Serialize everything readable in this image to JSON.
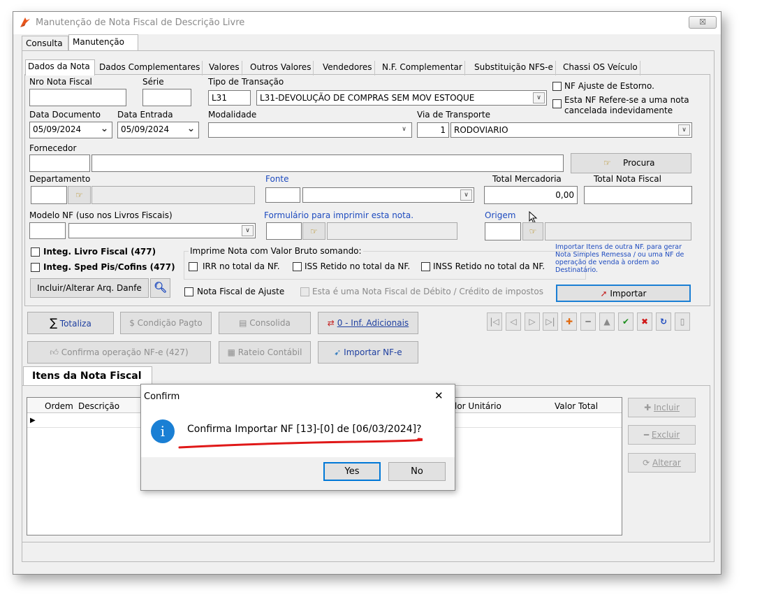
{
  "window": {
    "title": "Manutenção de Nota Fiscal de Descrição Livre",
    "close_label": "☒"
  },
  "top_tabs": [
    "Consulta",
    "Manutenção"
  ],
  "inner_tabs": [
    "Dados da Nota",
    "Dados Complementares",
    "Valores",
    "Outros Valores",
    "Vendedores",
    "N.F. Complementar",
    "Substituição NFS-e",
    "Chassi OS Veículo"
  ],
  "form": {
    "nro_nf_label": "Nro Nota Fiscal",
    "serie_label": "Série",
    "tipo_transacao_label": "Tipo de Transação",
    "tipo_transacao_code": "L31",
    "tipo_transacao_desc": "L31-DEVOLUÇÃO DE COMPRAS SEM MOV ESTOQUE",
    "nf_ajuste_estorno": "NF Ajuste de Estorno.",
    "nf_cancelada_line1": "Esta NF Refere-se a uma nota",
    "nf_cancelada_line2": "cancelada indevidamente",
    "data_documento_label": "Data Documento",
    "data_documento": "05/09/2024",
    "data_entrada_label": "Data Entrada",
    "data_entrada": "05/09/2024",
    "modalidade_label": "Modalidade",
    "via_transporte_label": "Via de Transporte",
    "via_transporte_code": "1",
    "via_transporte_desc": "RODOVIARIO",
    "fornecedor_label": "Fornecedor",
    "procura_label": "Procura",
    "departamento_label": "Departamento",
    "fonte_label": "Fonte",
    "total_mercadoria_label": "Total Mercadoria",
    "total_mercadoria": "0,00",
    "total_nf_label": "Total Nota Fiscal",
    "modelo_nf_label": "Modelo NF (uso nos Livros Fiscais)",
    "formulario_label": "Formulário para imprimir esta nota.",
    "origem_label": "Origem",
    "integ_livro_fiscal": "Integ. Livro Fiscal (477)",
    "integ_sped": "Integ. Sped Pis/Cofins (477)",
    "imprime_group_label": "Imprime Nota com Valor Bruto somando:",
    "irr_label": "IRR no total da NF.",
    "iss_label": "ISS Retido no total da NF.",
    "inss_label": "INSS Retido no total da NF.",
    "importar_info": "Importar Itens de outra NF. para gerar Nota Simples Remessa / ou uma NF de operação de venda à ordem ao Destinatário.",
    "incluir_danfe_label": "Incluir/Alterar Arq. Danfe",
    "nf_ajuste_label": "Nota Fiscal de Ajuste",
    "nf_debito_label": "Esta é uma Nota Fiscal de Débito / Crédito de impostos",
    "importar_label": "Importar"
  },
  "actions": {
    "totaliza": "Totaliza",
    "condicao_pagto": "Condição Pagto",
    "consolida": "Consolida",
    "inf_adicionais": "0 - Inf. Adicionais",
    "confirma_nfe": "Confirma operação NF-e (427)",
    "rateio_contabil": "Rateio Contábil",
    "importar_nfe": "Importar NF-e"
  },
  "items": {
    "title": "Itens da Nota Fiscal",
    "columns": [
      "Ordem",
      "Descrição",
      "lor Unitário",
      "Valor Total"
    ],
    "incluir": "Incluir",
    "excluir": "Excluir",
    "alterar": "Alterar"
  },
  "dialog": {
    "title": "Confirm",
    "close": "✕",
    "message": "Confirma Importar NF [13]-[0] de [06/03/2024]?",
    "yes": "Yes",
    "no": "No"
  },
  "colors": {
    "accent_blue": "#1e4bbf",
    "dialog_info": "#1a7fd4",
    "underline_red": "#e01818"
  }
}
